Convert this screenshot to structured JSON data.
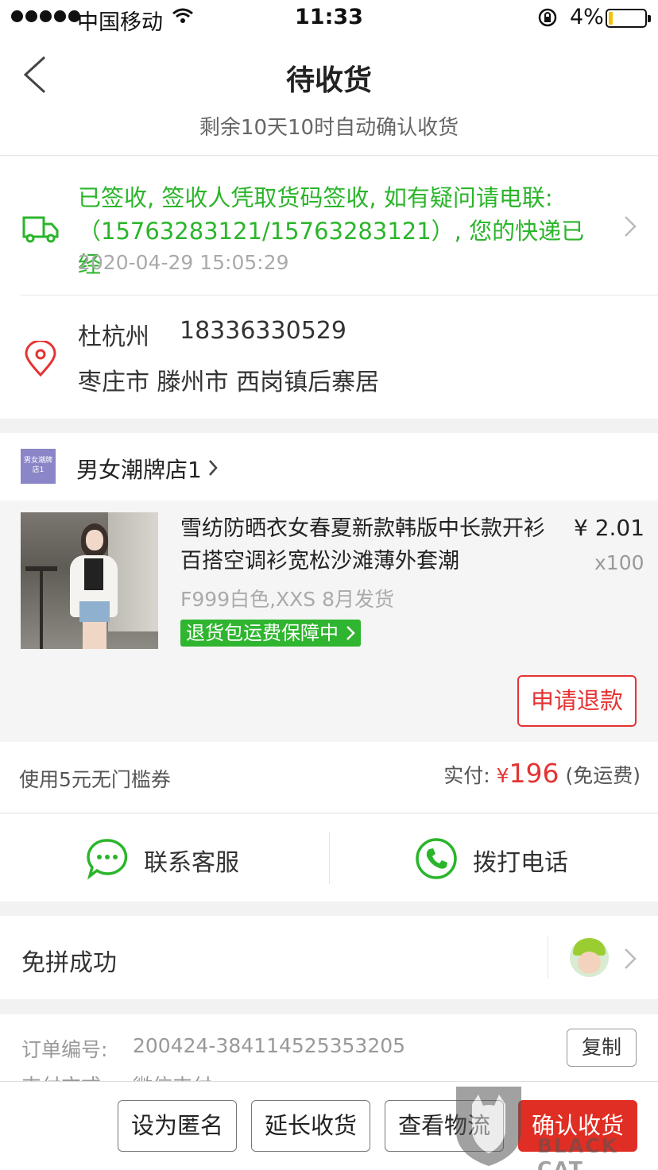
{
  "status_bar": {
    "carrier": "中国移动",
    "time": "11:33",
    "battery": "4%"
  },
  "header": {
    "title": "待收货",
    "subtitle": "剩余10天10时自动确认收货"
  },
  "logistics": {
    "latest_status": "已签收, 签收人凭取货码签收, 如有疑问请电联:（15763283121/15763283121）, 您的快递已经",
    "time": "2020-04-29 15:05:29"
  },
  "address": {
    "name": "杜杭州",
    "phone": "18336330529",
    "detail": "枣庄市 滕州市 西岗镇后寨居"
  },
  "shop": {
    "logo_text": "男女潮牌店1",
    "name": "男女潮牌店1"
  },
  "product": {
    "title": "雪纺防晒衣女春夏新款韩版中长款开衫百搭空调衫宽松沙滩薄外套潮",
    "price": "¥ 2.01",
    "quantity": "x100",
    "spec": "F999白色,XXS 8月发货",
    "badge": "退货包运费保障中"
  },
  "refund_button": "申请退款",
  "payment": {
    "coupon": "使用5元无门槛券",
    "paid_label": "实付:",
    "yen": "¥",
    "amount": "196",
    "shipping": "(免运费)"
  },
  "contact": {
    "service": "联系客服",
    "call": "拨打电话"
  },
  "group": {
    "label": "免拼成功"
  },
  "order": {
    "number_label": "订单编号:",
    "number_value": "200424-384114525353205",
    "copy_button": "复制",
    "pay_method_label": "支付方式:",
    "pay_method_value": "微信支付"
  },
  "bottom_actions": {
    "anonymous": "设为匿名",
    "extend": "延长收货",
    "track": "查看物流",
    "confirm": "确认收货"
  },
  "watermark": {
    "text": "BLACK CAT"
  },
  "colors": {
    "accent_red": "#e02e24",
    "status_green": "#2bb52b"
  }
}
